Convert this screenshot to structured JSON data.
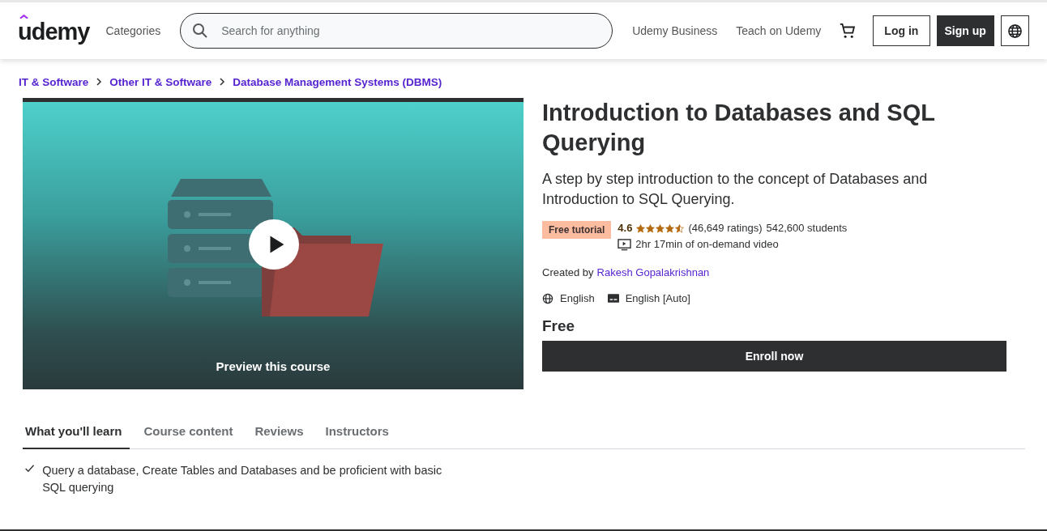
{
  "header": {
    "logo": "udemy",
    "categories": "Categories",
    "search": {
      "placeholder": "Search for anything"
    },
    "links": [
      "Udemy Business",
      "Teach on Udemy"
    ],
    "login": "Log in",
    "signup": "Sign up"
  },
  "breadcrumb": [
    "IT & Software",
    "Other IT & Software",
    "Database Management Systems (DBMS)"
  ],
  "preview": {
    "caption": "Preview this course"
  },
  "course": {
    "title": "Introduction to Databases and SQL Querying",
    "subtitle": "A step by step introduction to the concept of Databases and Introduction to SQL Querying.",
    "badge": "Free tutorial",
    "rating": "4.6",
    "stars": 4.5,
    "ratings_count": "(46,649 ratings)",
    "students": "542,600 students",
    "video_length": "2hr 17min of on-demand video",
    "created_by_label": "Created by",
    "instructor": "Rakesh Gopalakrishnan",
    "language": "English",
    "captions": "English [Auto]",
    "price": "Free",
    "enroll": "Enroll now"
  },
  "tabs": [
    {
      "label": "What you'll learn",
      "selected": true
    },
    {
      "label": "Course content",
      "selected": false
    },
    {
      "label": "Reviews",
      "selected": false
    },
    {
      "label": "Instructors",
      "selected": false
    }
  ],
  "learn_items": [
    "Query a database, Create Tables and Databases and be proficient with basic SQL querying"
  ]
}
